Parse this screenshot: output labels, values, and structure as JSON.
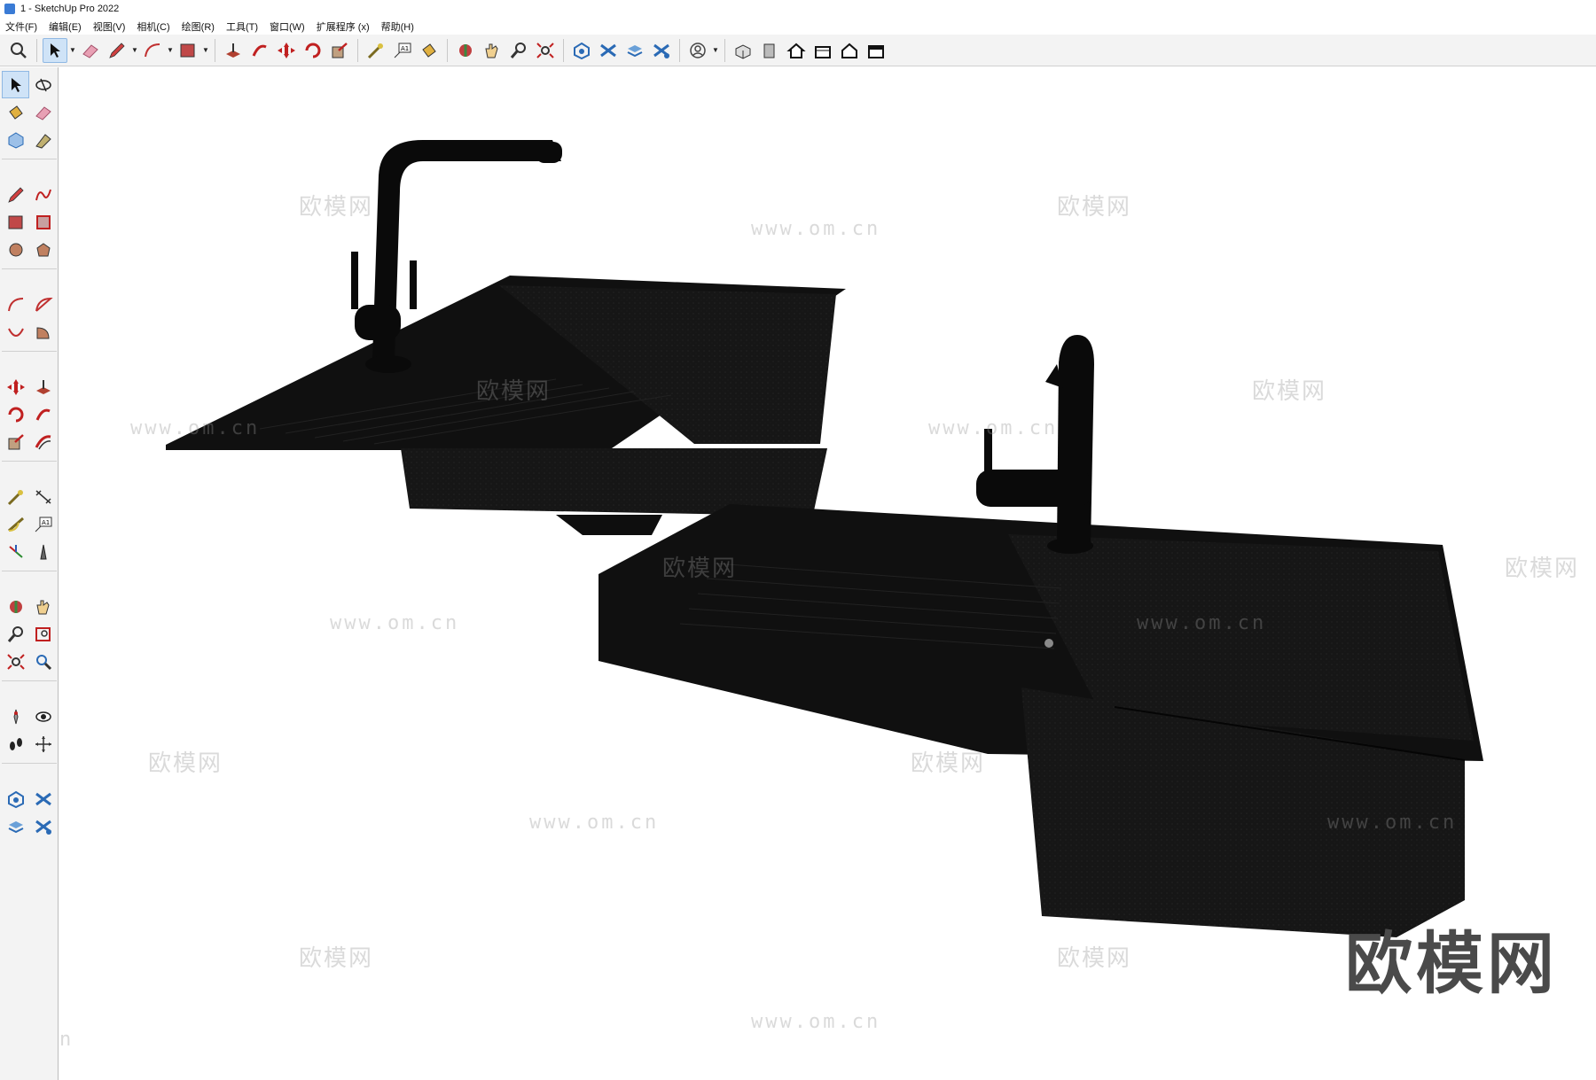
{
  "window": {
    "title": "1 - SketchUp Pro 2022"
  },
  "menu": [
    "文件(F)",
    "编辑(E)",
    "视图(V)",
    "相机(C)",
    "绘图(R)",
    "工具(T)",
    "窗口(W)",
    "扩展程序 (x)",
    "帮助(H)"
  ],
  "toolbar_icons": [
    "search-icon",
    "select-icon",
    "eraser-icon",
    "pencil-icon",
    "arc-icon",
    "rectangle-icon",
    "pushpull-icon",
    "follow-me-icon",
    "move-icon",
    "rotate-icon",
    "scale-icon",
    "tape-measure-icon",
    "text-icon",
    "paint-bucket-icon",
    "orbit-icon",
    "pan-icon",
    "zoom-icon",
    "zoom-extents-icon",
    "warehouse-icon",
    "extension-icon",
    "layer-icon",
    "scenes-icon",
    "account-icon",
    "iso-view-icon",
    "front-view-icon",
    "home-icon",
    "top-view-icon",
    "house-view-icon",
    "back-view-icon"
  ],
  "palette_icons": [
    "select-icon",
    "orbit-icon",
    "paint-bucket-icon",
    "eraser-icon",
    "component-icon",
    "tag-icon",
    "pencil-icon",
    "freehand-icon",
    "rectangle-icon",
    "rotated-rect-icon",
    "circle-icon",
    "polygon-icon",
    "arc-icon",
    "arc2-icon",
    "pie-icon",
    "3pt-arc-icon",
    "move-icon",
    "pushpull-icon",
    "rotate-icon",
    "follow-me-icon",
    "scale-icon",
    "offset-icon",
    "tape-measure-icon",
    "dimension-icon",
    "protractor-icon",
    "text-icon",
    "axes-icon",
    "3d-text-icon",
    "section-icon",
    "walk-icon",
    "zoom-icon",
    "zoom-window-icon",
    "zoom-extents-icon",
    "previous-view-icon",
    "position-camera-icon",
    "look-around-icon",
    "footprints-icon",
    "pan-icon",
    "warehouse-icon",
    "extension-icon",
    "layer-icon",
    "scenes-icon"
  ],
  "watermarks": {
    "brand": "欧模网",
    "url": "www.om.cn",
    "url_short": "om.cn"
  },
  "colors": {
    "accent": "#3a7bd5",
    "sink": "#151515",
    "faucet": "#0a0a0a"
  }
}
